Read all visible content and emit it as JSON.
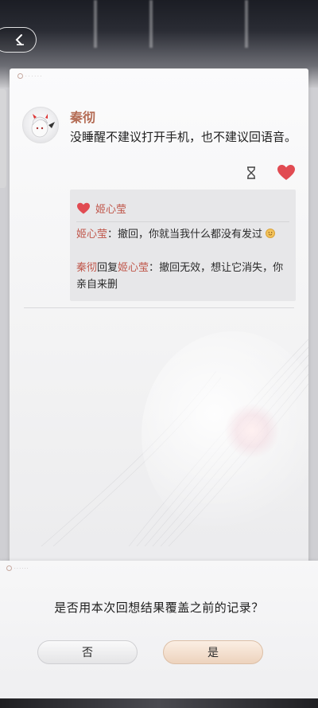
{
  "post": {
    "author": "秦彻",
    "text": "没睡醒不建议打开手机，也不建议回语音。"
  },
  "likes": {
    "name": "姬心莹"
  },
  "comments": [
    {
      "name": "姬心莹",
      "sep": "：",
      "text": "撤回，你就当我什么都没有发过"
    },
    {
      "name": "秦彻",
      "reply_word": "回复",
      "reply_to": "姬心莹",
      "sep": "：",
      "text": "撤回无效，想让它消失，你亲自来删"
    }
  ],
  "dialog": {
    "question": "是否用本次回想结果覆盖之前的记录？",
    "no_label": "否",
    "yes_label": "是"
  },
  "icons": {
    "back": "back-arrow-icon",
    "hourglass": "hourglass-icon",
    "heart": "heart-icon",
    "emoji": "smile-emoji-icon"
  },
  "colors": {
    "name_accent": "#c0574b",
    "author_accent": "#b46c55",
    "heart": "#e14b52"
  }
}
